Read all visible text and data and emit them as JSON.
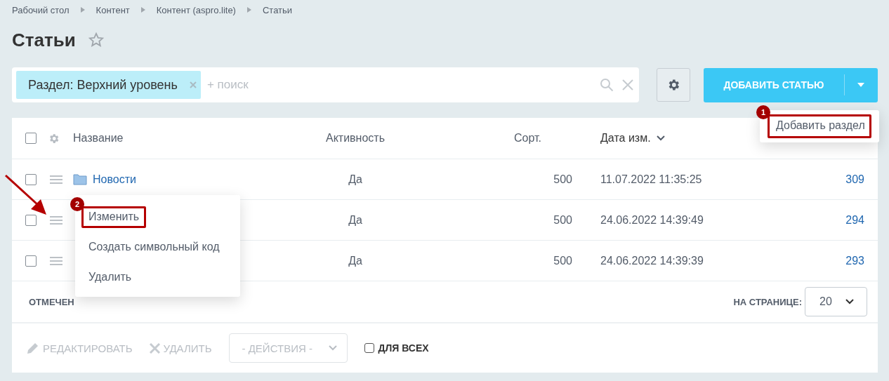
{
  "breadcrumbs": [
    "Рабочий стол",
    "Контент",
    "Контент (aspro.lite)",
    "Статьи"
  ],
  "title": "Статьи",
  "filter": {
    "chip": "Раздел: Верхний уровень",
    "placeholder": "+ поиск"
  },
  "add_button": {
    "label": "ДОБАВИТЬ СТАТЬЮ",
    "menu": [
      {
        "label": "Добавить раздел",
        "highlighted": true,
        "badge": "1"
      }
    ]
  },
  "table": {
    "all_checked": false,
    "columns": [
      {
        "label": "Название",
        "sorted": false
      },
      {
        "label": "Активность",
        "sorted": false
      },
      {
        "label": "Сорт.",
        "sorted": false
      },
      {
        "label": "Дата изм.",
        "sorted": true
      }
    ],
    "rows": [
      {
        "checked": false,
        "name": "Новости",
        "active": "Да",
        "sort": "500",
        "date": "11.07.2022 11:35:25",
        "id": "309"
      },
      {
        "checked": false,
        "active": "Да",
        "sort": "500",
        "date": "24.06.2022 14:39:49",
        "id": "294"
      },
      {
        "checked": false,
        "active": "Да",
        "sort": "500",
        "date": "24.06.2022 14:39:39",
        "id": "293"
      }
    ]
  },
  "context_menu": [
    {
      "label": "Изменить",
      "highlighted": true,
      "badge": "2"
    },
    {
      "label": "Создать символьный код",
      "highlighted": false
    },
    {
      "label": "Удалить",
      "highlighted": false
    }
  ],
  "footer": {
    "selected_label": "ОТМЕЧЕН",
    "per_page_label": "НА СТРАНИЦЕ:",
    "per_page": "20"
  },
  "actions": {
    "edit": {
      "label": "РЕДАКТИРОВАТЬ",
      "disabled": true
    },
    "delete": {
      "label": "УДАЛИТЬ",
      "disabled": true
    },
    "select": "- ДЕЙСТВИЯ -",
    "for_all": {
      "label": "ДЛЯ ВСЕХ",
      "checked": false
    }
  }
}
